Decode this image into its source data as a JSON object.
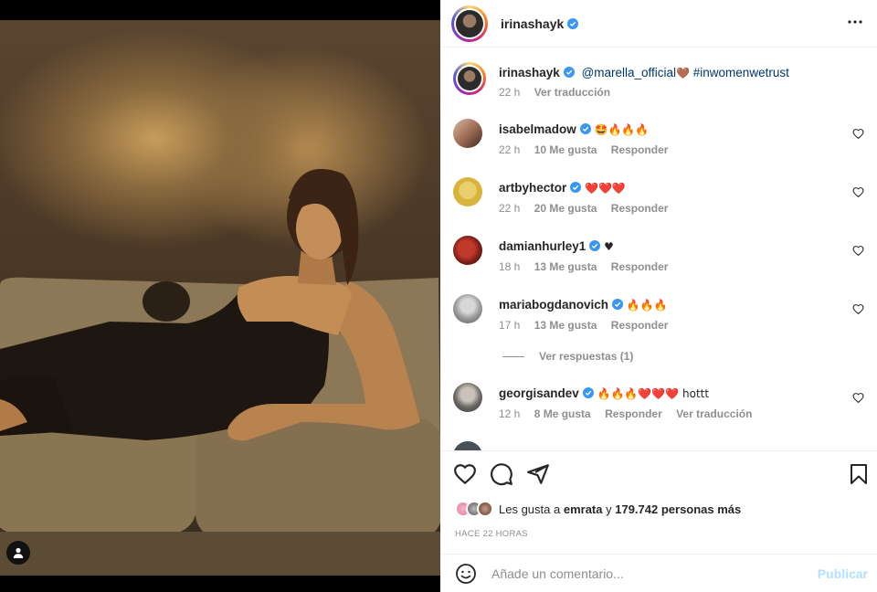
{
  "post": {
    "author": "irinashayk",
    "caption_mention": "@marella_official",
    "caption_emoji": "🤎",
    "caption_hashtag": "#inwomenwetrust",
    "caption_time": "22 h",
    "translate_label": "Ver traducción"
  },
  "comments": [
    {
      "user": "isabelmadow",
      "text": "🤩🔥🔥🔥",
      "time": "22 h",
      "likes": "10 Me gusta",
      "reply": "Responder"
    },
    {
      "user": "artbyhector",
      "text": "❤️❤️❤️",
      "time": "22 h",
      "likes": "20 Me gusta",
      "reply": "Responder"
    },
    {
      "user": "damianhurley1",
      "text": "♥",
      "time": "18 h",
      "likes": "13 Me gusta",
      "reply": "Responder"
    },
    {
      "user": "mariabogdanovich",
      "text": "🔥🔥🔥",
      "time": "17 h",
      "likes": "13 Me gusta",
      "reply": "Responder"
    },
    {
      "user": "georgisandev",
      "text": "🔥🔥🔥❤️❤️❤️ hottt",
      "time": "12 h",
      "likes": "8 Me gusta",
      "reply": "Responder",
      "translate": "Ver traducción"
    }
  ],
  "view_replies": "Ver respuestas (1)",
  "likes_summary": {
    "prefix": "Les gusta a",
    "first_user": "emrata",
    "connector": "y",
    "others": "179.742 personas más"
  },
  "posted_ago": "HACE 22 HORAS",
  "comment_box": {
    "placeholder": "Añade un comentario...",
    "post_label": "Publicar"
  },
  "colors": {
    "verified": "#3897f0",
    "link": "#00376b",
    "muted": "#8e8e8e",
    "post_disabled": "#b2dffc"
  },
  "icons": [
    "more-icon",
    "verified-icon",
    "heart-icon",
    "comment-icon",
    "share-icon",
    "bookmark-icon",
    "emoji-icon",
    "user-tag-icon"
  ]
}
